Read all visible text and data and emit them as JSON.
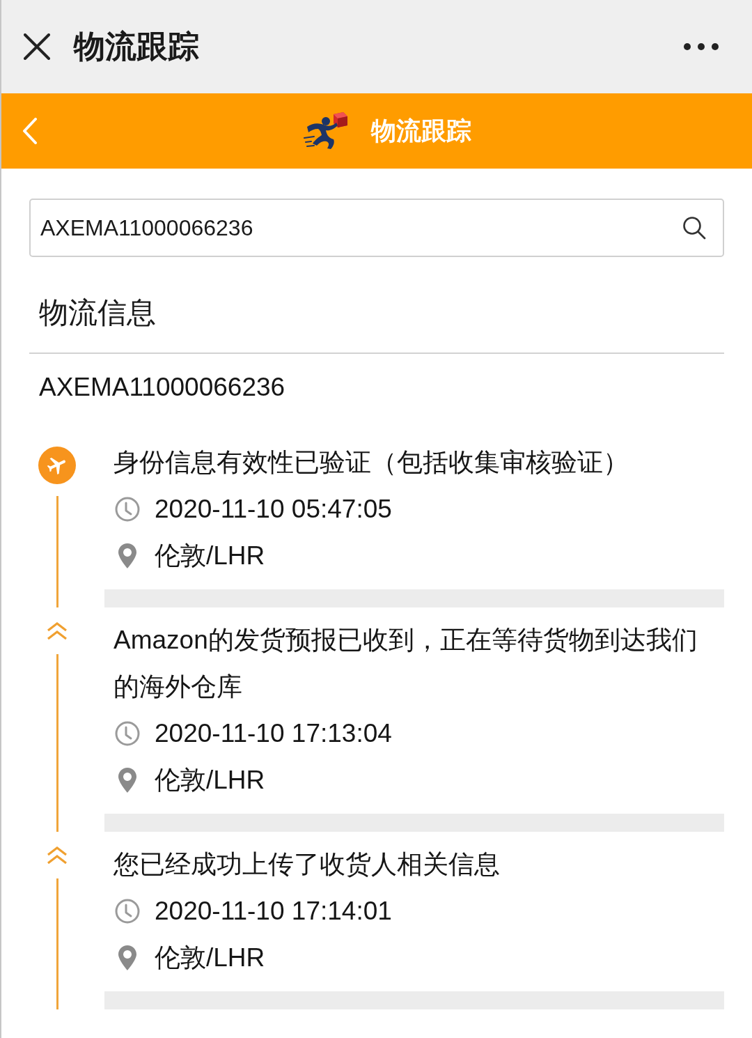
{
  "window": {
    "title": "物流跟踪"
  },
  "header": {
    "title": "物流跟踪"
  },
  "search": {
    "value": "AXEMA11000066236"
  },
  "section": {
    "title": "物流信息"
  },
  "tracking_number": "AXEMA11000066236",
  "events": [
    {
      "kind": "current",
      "description": "身份信息有效性已验证（包括收集审核验证）",
      "time": "2020-11-10 05:47:05",
      "location": "伦敦/LHR"
    },
    {
      "kind": "past",
      "description": "Amazon的发货预报已收到，正在等待货物到达我们的海外仓库",
      "time": "2020-11-10 17:13:04",
      "location": "伦敦/LHR"
    },
    {
      "kind": "past",
      "description": "您已经成功上传了收货人相关信息",
      "time": "2020-11-10 17:14:01",
      "location": "伦敦/LHR"
    }
  ]
}
